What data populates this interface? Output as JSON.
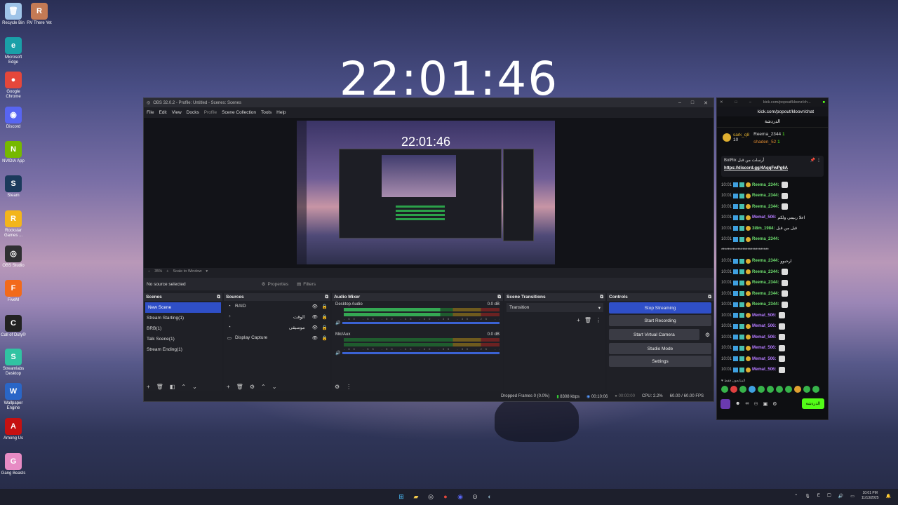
{
  "desktop": {
    "clock": "22:01:46",
    "icons": [
      {
        "label": "Recycle Bin",
        "glyph": "🗑",
        "color": "#9fc4e8"
      },
      {
        "label": "RV There Yet",
        "glyph": "R",
        "color": "#c47a55"
      },
      {
        "label": "Microsoft Edge",
        "glyph": "e",
        "color": "#1aa0a8"
      },
      {
        "label": "Google Chrome",
        "glyph": "●",
        "color": "#e5473b"
      },
      {
        "label": "Discord",
        "glyph": "◉",
        "color": "#5865f2"
      },
      {
        "label": "NVIDIA App",
        "glyph": "N",
        "color": "#76b900"
      },
      {
        "label": "Steam",
        "glyph": "S",
        "color": "#1b3a5c"
      },
      {
        "label": "Rockstar Games ...",
        "glyph": "R",
        "color": "#f3b51b"
      },
      {
        "label": "OBS Studio",
        "glyph": "◎",
        "color": "#303033"
      },
      {
        "label": "FiveM",
        "glyph": "F",
        "color": "#f26a1b"
      },
      {
        "label": "Call of Duty®",
        "glyph": "C",
        "color": "#222"
      },
      {
        "label": "Streamlabs Desktop",
        "glyph": "S",
        "color": "#31c3a2"
      },
      {
        "label": "Wallpaper Engine",
        "glyph": "W",
        "color": "#2a66c7"
      },
      {
        "label": "Among Us",
        "glyph": "A",
        "color": "#c51111"
      },
      {
        "label": "Gang Beasts",
        "glyph": "G",
        "color": "#e78bc4"
      }
    ]
  },
  "obs": {
    "title": "OBS 32.0.2 - Profile: Untitled - Scenes: Scenes",
    "window_controls": [
      "–",
      "□",
      "✕"
    ],
    "menu": [
      "File",
      "Edit",
      "View",
      "Docks",
      "Profile",
      "Scene Collection",
      "Tools",
      "Help"
    ],
    "preview_clock": "22:01:46",
    "zoom": "35%",
    "scale": "Scale to Window",
    "no_source": "No source selected",
    "properties": "Properties",
    "filters": "Filters",
    "scenes": {
      "title": "Scenes",
      "items": [
        "New Scene",
        "Stream Starting(1)",
        "BRB(1)",
        "Talk Scene(1)",
        "Stream Ending(1)"
      ]
    },
    "sources": {
      "title": "Sources",
      "items": [
        "RAID",
        "الوقت",
        "موسيقى",
        "Display Capture"
      ]
    },
    "mixer": {
      "title": "Audio Mixer",
      "channels": [
        {
          "name": "Desktop Audio",
          "db": "0.0 dB",
          "level": 0.62
        },
        {
          "name": "Mic/Aux",
          "db": "0.0 dB",
          "level": 0.0
        }
      ],
      "ticks": "-60 -55 -50 -45 -40 -35 -30 -25 -20 -15 -10 -5 0"
    },
    "transitions": {
      "title": "Scene Transitions",
      "selected": "Transition"
    },
    "controls": {
      "title": "Controls",
      "buttons": [
        "Stop Streaming",
        "Start Recording",
        "Start Virtual Camera",
        "Studio Mode",
        "Settings"
      ]
    },
    "status": {
      "dropped": "Dropped Frames 0 (0.0%)",
      "bitrate": "8308 kbps",
      "stream_time": "00:10:06",
      "rec_time": "00:00:00",
      "cpu": "CPU: 2.2%",
      "fps": "60.00 / 60.00 FPS"
    },
    "colors": {
      "accent": "#2f4fc7",
      "bg": "#1e1f25"
    }
  },
  "kick": {
    "tab": "kick.com/popout/kloovr/ch...",
    "url": "kick.com/popout/kloovr/chat",
    "header": "الدردشة",
    "top_users": [
      {
        "name": "sark_q8",
        "count": "10"
      },
      {
        "name": "Reema_2344",
        "count": "1"
      },
      {
        "name": "shaden_52",
        "count": "1"
      }
    ],
    "pinned_by": "BotRix أرسلت من قبل",
    "pinned_url": "https://discord.gg/4AqqFwPg6A",
    "messages": [
      {
        "time": "10:01",
        "user": "Reema_2344:",
        "text": "",
        "color": "#6fe06f",
        "gift": true
      },
      {
        "time": "10:01",
        "user": "Reema_2344:",
        "text": "",
        "color": "#6fe06f",
        "gift": true
      },
      {
        "time": "10:01",
        "user": "Reema_2344:",
        "text": "",
        "color": "#6fe06f",
        "gift": true
      },
      {
        "time": "10:01",
        "user": "Memat_506:",
        "text": "اعلا ربيمي ولكم",
        "color": "#b57bff",
        "gift": false
      },
      {
        "time": "10:01",
        "user": "3i8m_1984:",
        "text": "قبل من قبل",
        "color": "#6fe06f",
        "gift": false
      },
      {
        "time": "10:01",
        "user": "Reema_2344:",
        "text": "",
        "color": "#6fe06f",
        "gift": false
      },
      {
        "time": "",
        "user": "",
        "text": "*****************************",
        "color": "#eee",
        "gift": false
      },
      {
        "time": "10:01",
        "user": "Reema_2344:",
        "text": "ارحبوو",
        "color": "#6fe06f",
        "gift": false
      },
      {
        "time": "10:01",
        "user": "Reema_2344:",
        "text": "",
        "color": "#6fe06f",
        "gift": true
      },
      {
        "time": "10:01",
        "user": "Reema_2344:",
        "text": "",
        "color": "#6fe06f",
        "gift": true
      },
      {
        "time": "10:01",
        "user": "Reema_2344:",
        "text": "",
        "color": "#6fe06f",
        "gift": true
      },
      {
        "time": "10:01",
        "user": "Reema_2344:",
        "text": "",
        "color": "#6fe06f",
        "gift": true
      },
      {
        "time": "10:01",
        "user": "Memat_506:",
        "text": "",
        "color": "#b57bff",
        "gift": true
      },
      {
        "time": "10:01",
        "user": "Memat_506:",
        "text": "",
        "color": "#b57bff",
        "gift": true
      },
      {
        "time": "10:01",
        "user": "Memat_506:",
        "text": "",
        "color": "#b57bff",
        "gift": true
      },
      {
        "time": "10:01",
        "user": "Memat_506:",
        "text": "",
        "color": "#b57bff",
        "gift": true
      },
      {
        "time": "10:01",
        "user": "Memat_506:",
        "text": "",
        "color": "#b57bff",
        "gift": true
      },
      {
        "time": "10:01",
        "user": "Memat_506:",
        "text": "",
        "color": "#b57bff",
        "gift": true
      }
    ],
    "following": "♥ المتابعون فقط",
    "send": "الدردشة"
  },
  "taskbar": {
    "lang": "E",
    "time": "10:01 PM",
    "date": "11/13/2025"
  }
}
